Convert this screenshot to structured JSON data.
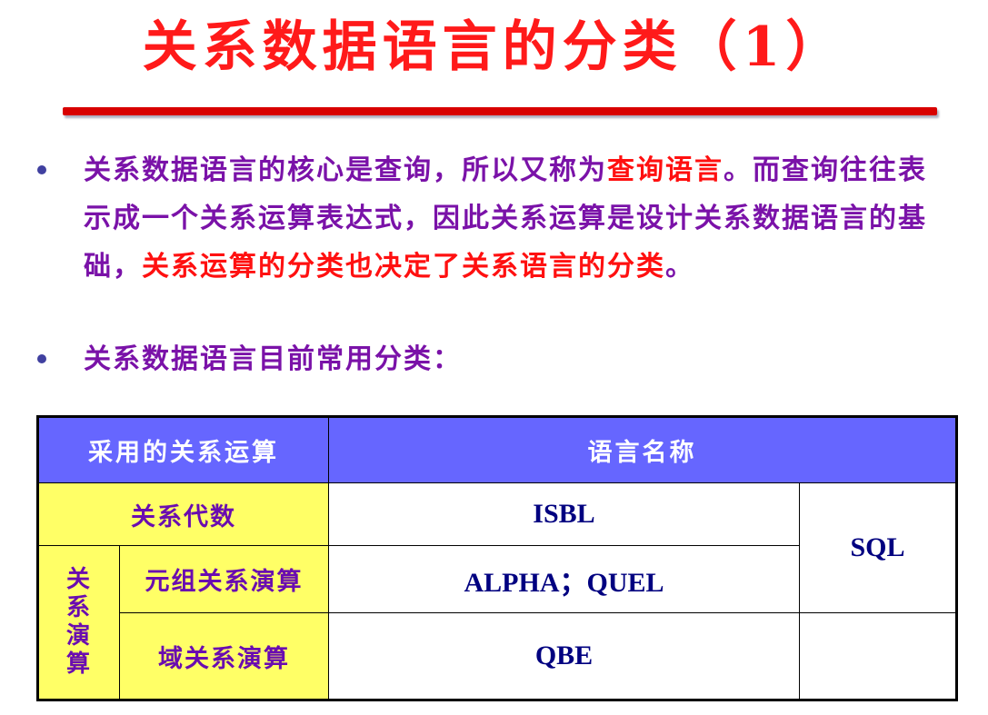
{
  "slide": {
    "title": "关系数据语言的分类（1）",
    "bullets": [
      {
        "parts": [
          {
            "text": "关系数据语言的核心是查询，所以又称为",
            "highlight": false
          },
          {
            "text": "查询语言",
            "highlight": true
          },
          {
            "text": "。而查询往往表示成一个关系运算表达式，因此关系运算是设计关系数据语言的基础，",
            "highlight": false
          },
          {
            "text": "关系运算的分类也决定了关系语言的分类",
            "highlight": true
          },
          {
            "text": "。",
            "highlight": false
          }
        ]
      },
      {
        "parts": [
          {
            "text": "关系数据语言目前常用分类：",
            "highlight": false
          }
        ]
      }
    ]
  },
  "table": {
    "headers": [
      "采用的关系运算",
      "语言名称"
    ],
    "group_label": [
      "关",
      "系",
      "演",
      "算"
    ],
    "rows": [
      {
        "operation": "关系代数",
        "language": "ISBL"
      },
      {
        "operation": "元组关系演算",
        "language": "ALPHA；QUEL"
      },
      {
        "operation": "域关系演算",
        "language": "QBE"
      }
    ],
    "sql_label": "SQL"
  },
  "colors": {
    "title": "#ff1a1a",
    "body_text": "#7a12a8",
    "highlight_text": "#ff1010",
    "rule": "#d80000",
    "header_bg": "#6666ff",
    "operation_bg": "#ffff66",
    "language_text": "#000080"
  }
}
